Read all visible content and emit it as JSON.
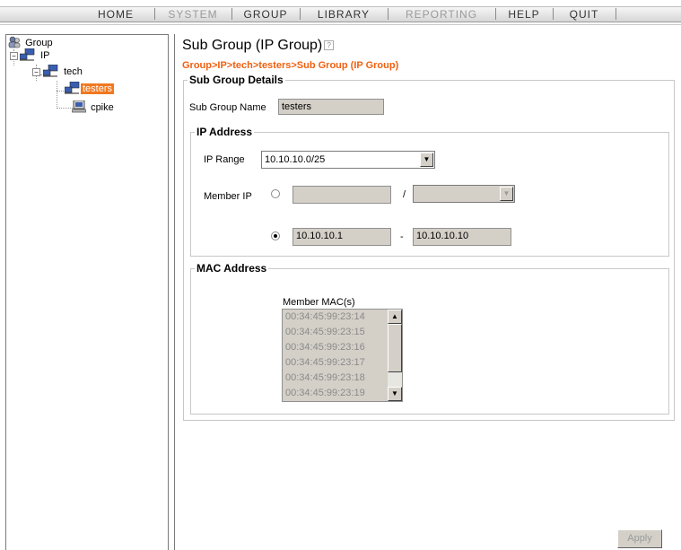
{
  "menu": {
    "items": [
      {
        "label": "HOME",
        "disabled": false
      },
      {
        "label": "SYSTEM",
        "disabled": true
      },
      {
        "label": "GROUP",
        "disabled": false
      },
      {
        "label": "LIBRARY",
        "disabled": false
      },
      {
        "label": "REPORTING",
        "disabled": true
      },
      {
        "label": "HELP",
        "disabled": false
      },
      {
        "label": "QUIT",
        "disabled": false
      }
    ]
  },
  "tree": {
    "root": "Group",
    "ip": "IP",
    "tech": "tech",
    "testers": "testers",
    "cpike": "cpike"
  },
  "page": {
    "title": "Sub Group (IP Group)",
    "breadcrumb": "Group>IP>tech>testers>Sub Group (IP Group)"
  },
  "details": {
    "legend": "Sub Group Details",
    "name_label": "Sub Group Name",
    "name_value": "testers"
  },
  "ip_address": {
    "legend": "IP Address",
    "range_label": "IP Range",
    "range_value": "10.10.10.0/25",
    "member_label": "Member IP",
    "slash": "/",
    "dash": "-",
    "start_ip": "10.10.10.1",
    "end_ip": "10.10.10.10"
  },
  "mac_address": {
    "legend": "MAC Address",
    "list_label": "Member MAC(s)",
    "macs": [
      "00:34:45:99:23:14",
      "00:34:45:99:23:15",
      "00:34:45:99:23:16",
      "00:34:45:99:23:17",
      "00:34:45:99:23:18",
      "00:34:45:99:23:19"
    ]
  },
  "apply_label": "Apply",
  "colors": {
    "accent": "#f06010",
    "selection": "#f07820"
  }
}
